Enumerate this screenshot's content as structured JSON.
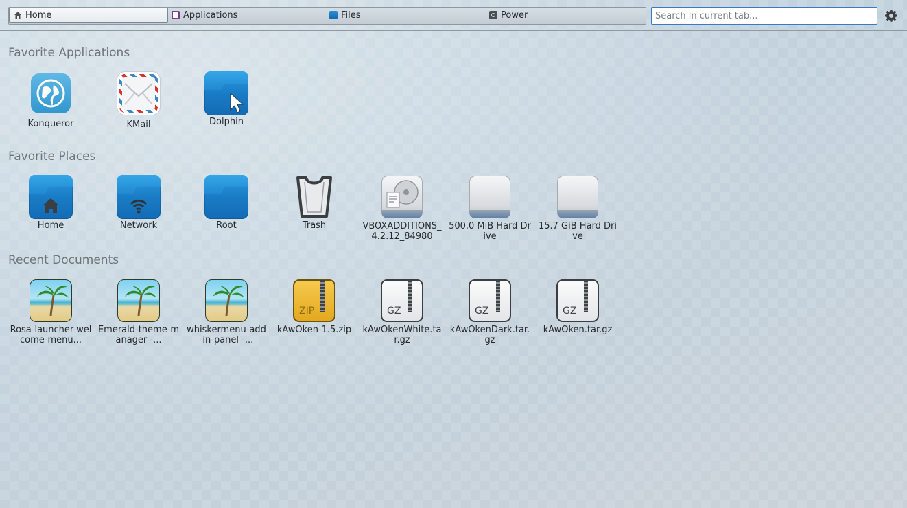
{
  "tabs": [
    {
      "label": "Home",
      "icon": "home-icon"
    },
    {
      "label": "Applications",
      "icon": "applications-icon"
    },
    {
      "label": "Files",
      "icon": "files-icon"
    },
    {
      "label": "Power",
      "icon": "power-icon"
    }
  ],
  "search": {
    "placeholder": "Search in current tab..."
  },
  "settings_icon": "gear-icon",
  "sections": {
    "favorite_applications": {
      "title": "Favorite Applications",
      "items": [
        {
          "label": "Konqueror",
          "icon": "globe-icon"
        },
        {
          "label": "KMail",
          "icon": "mail-icon"
        },
        {
          "label": "Dolphin",
          "icon": "folder-cursor-icon"
        }
      ]
    },
    "favorite_places": {
      "title": "Favorite Places",
      "items": [
        {
          "label": "Home",
          "icon": "home-folder-icon"
        },
        {
          "label": "Network",
          "icon": "network-folder-icon"
        },
        {
          "label": "Root",
          "icon": "folder-icon"
        },
        {
          "label": "Trash",
          "icon": "trash-icon"
        },
        {
          "label": "VBOXADDITIONS_4.2.12_84980",
          "icon": "optical-drive-icon"
        },
        {
          "label": "500.0 MiB Hard Drive",
          "icon": "hard-drive-icon"
        },
        {
          "label": "15.7 GiB Hard Drive",
          "icon": "hard-drive-icon"
        }
      ]
    },
    "recent_documents": {
      "title": "Recent Documents",
      "items": [
        {
          "label": "Rosa-launcher-welcome-menu...",
          "icon": "image-icon"
        },
        {
          "label": "Emerald-theme-manager -...",
          "icon": "image-icon"
        },
        {
          "label": "whiskermenu-add-in-panel -...",
          "icon": "image-icon"
        },
        {
          "label": "kAwOken-1.5.zip",
          "icon": "zip-archive-icon",
          "format": "ZIP"
        },
        {
          "label": "kAwOkenWhite.tar.gz",
          "icon": "gz-archive-icon",
          "format": "GZ"
        },
        {
          "label": "kAwOkenDark.tar.gz",
          "icon": "gz-archive-icon",
          "format": "GZ"
        },
        {
          "label": "kAwOken.tar.gz",
          "icon": "gz-archive-icon",
          "format": "GZ"
        }
      ]
    }
  },
  "colors": {
    "accent": "#3c78c4",
    "folder_blue": "#1a7cc6"
  }
}
